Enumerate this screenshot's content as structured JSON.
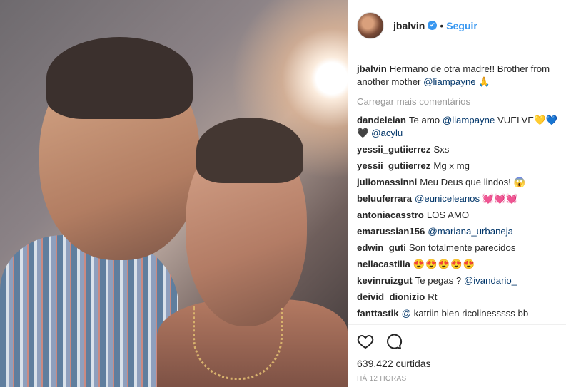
{
  "post": {
    "username": "jbalvin",
    "verified_icon": "✔",
    "separator": "•",
    "follow_label": "Seguir"
  },
  "caption": {
    "username": "jbalvin",
    "text_a": "Hermano de otra madre!! Brother from another mother ",
    "mention": "@liampayne",
    "emoji": "🙏"
  },
  "load_more": "Carregar mais comentários",
  "comments": [
    {
      "user": "dandeleian",
      "text_a": "Te amo ",
      "mention": "@liampayne",
      "text_b": " VUELVE💛💙🖤 ",
      "mention2": "@acylu"
    },
    {
      "user": "yessii_gutiierrez",
      "text_a": "Sxs"
    },
    {
      "user": "yessii_gutiierrez",
      "text_a": "Mg x mg"
    },
    {
      "user": "juliomassinni",
      "text_a": "Meu Deus que lindos! 😱"
    },
    {
      "user": "beluuferrara",
      "mention": "@euniceleanos",
      "text_b": " 💓💓💓"
    },
    {
      "user": "antoniacasstro",
      "text_a": "LOS AMO"
    },
    {
      "user": "emarussian156",
      "mention": "@mariana_urbaneja"
    },
    {
      "user": "edwin_guti",
      "text_a": "Son totalmente parecidos"
    },
    {
      "user": "nellacastilla",
      "text_a": "😍😍😍😍😍"
    },
    {
      "user": "kevinruizgut",
      "text_a": "Te pegas ? ",
      "mention": "@ivandario_"
    },
    {
      "user": "deivid_dionizio",
      "text_a": "Rt"
    },
    {
      "user": "fanttastik",
      "mention": "@",
      "text_b": "       katriin bien ricolinesssss bb"
    }
  ],
  "likes": "639.422 curtidas",
  "time": "HÁ 12 HORAS",
  "icons": {
    "like": "heart-icon",
    "comment": "comment-icon",
    "verified": "verified-badge-icon"
  },
  "colors": {
    "accent": "#3897f0",
    "mention": "#003569",
    "muted": "#999999"
  }
}
